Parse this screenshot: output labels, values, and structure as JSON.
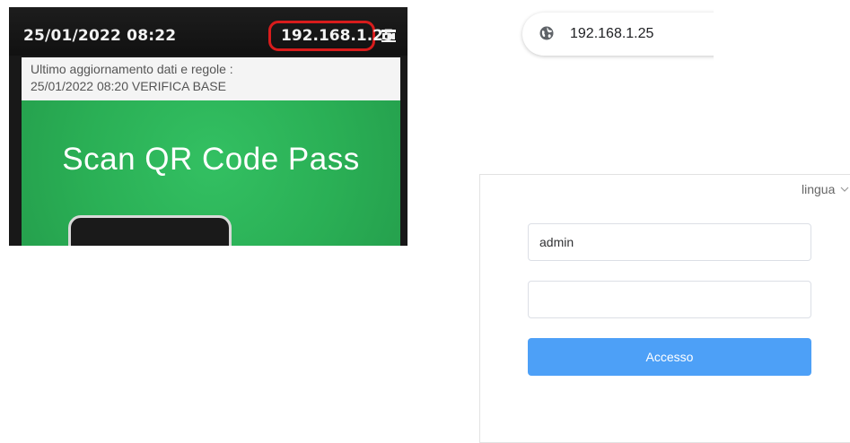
{
  "device": {
    "datetime": "25/01/2022 08:22",
    "ip_address": "192.168.1.25",
    "update_line1": "Ultimo aggiornamento dati e regole :",
    "update_line2": "25/01/2022 08:20 VERIFICA BASE",
    "scan_prompt": "Scan QR Code Pass",
    "highlight_color": "#d81c1c",
    "screen_color": "#2bb257"
  },
  "browser": {
    "url": "192.168.1.25",
    "icon": "globe-icon"
  },
  "login": {
    "language_label": "lingua",
    "username_value": "admin",
    "password_value": "",
    "submit_label": "Accesso",
    "button_color": "#4da0f7"
  }
}
